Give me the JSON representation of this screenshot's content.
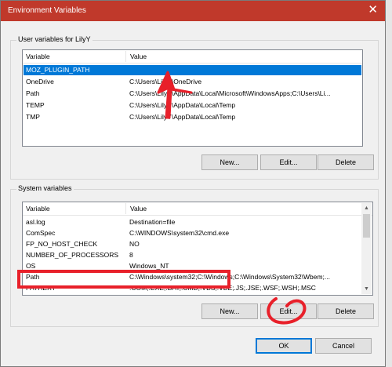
{
  "window": {
    "title": "Environment Variables",
    "close_glyph": "✕"
  },
  "user_vars": {
    "group_label": "User variables for LilyY",
    "columns": [
      "Variable",
      "Value"
    ],
    "rows": [
      {
        "name": "MOZ_PLUGIN_PATH",
        "value": ""
      },
      {
        "name": "OneDrive",
        "value": "C:\\Users\\LilyY\\OneDrive"
      },
      {
        "name": "Path",
        "value": "C:\\Users\\LilyY\\AppData\\Local\\Microsoft\\WindowsApps;C:\\Users\\Li..."
      },
      {
        "name": "TEMP",
        "value": "C:\\Users\\LilyY\\AppData\\Local\\Temp"
      },
      {
        "name": "TMP",
        "value": "C:\\Users\\LilyY\\AppData\\Local\\Temp"
      }
    ],
    "selected_row": "MOZ_PLUGIN_PATH",
    "buttons": {
      "new": "New...",
      "edit": "Edit...",
      "delete": "Delete"
    }
  },
  "system_vars": {
    "group_label": "System variables",
    "columns": [
      "Variable",
      "Value"
    ],
    "rows": [
      {
        "name": "asl.log",
        "value": "Destination=file"
      },
      {
        "name": "ComSpec",
        "value": "C:\\WINDOWS\\system32\\cmd.exe"
      },
      {
        "name": "FP_NO_HOST_CHECK",
        "value": "NO"
      },
      {
        "name": "NUMBER_OF_PROCESSORS",
        "value": "8"
      },
      {
        "name": "OS",
        "value": "Windows_NT"
      },
      {
        "name": "Path",
        "value": "C:\\Windows\\system32;C:\\Windows;C:\\Windows\\System32\\Wbem;..."
      },
      {
        "name": "PATHEXT",
        "value": ".COM;.EXE;.BAT;.CMD;.VBS;.VBE;.JS;.JSE;.WSF;.WSH;.MSC"
      }
    ],
    "buttons": {
      "new": "New...",
      "edit": "Edit...",
      "delete": "Delete"
    }
  },
  "footer": {
    "ok": "OK",
    "cancel": "Cancel"
  },
  "colors": {
    "title_bar": "#c0392b",
    "selection": "#0078d7",
    "annotation": "#e8202a"
  }
}
